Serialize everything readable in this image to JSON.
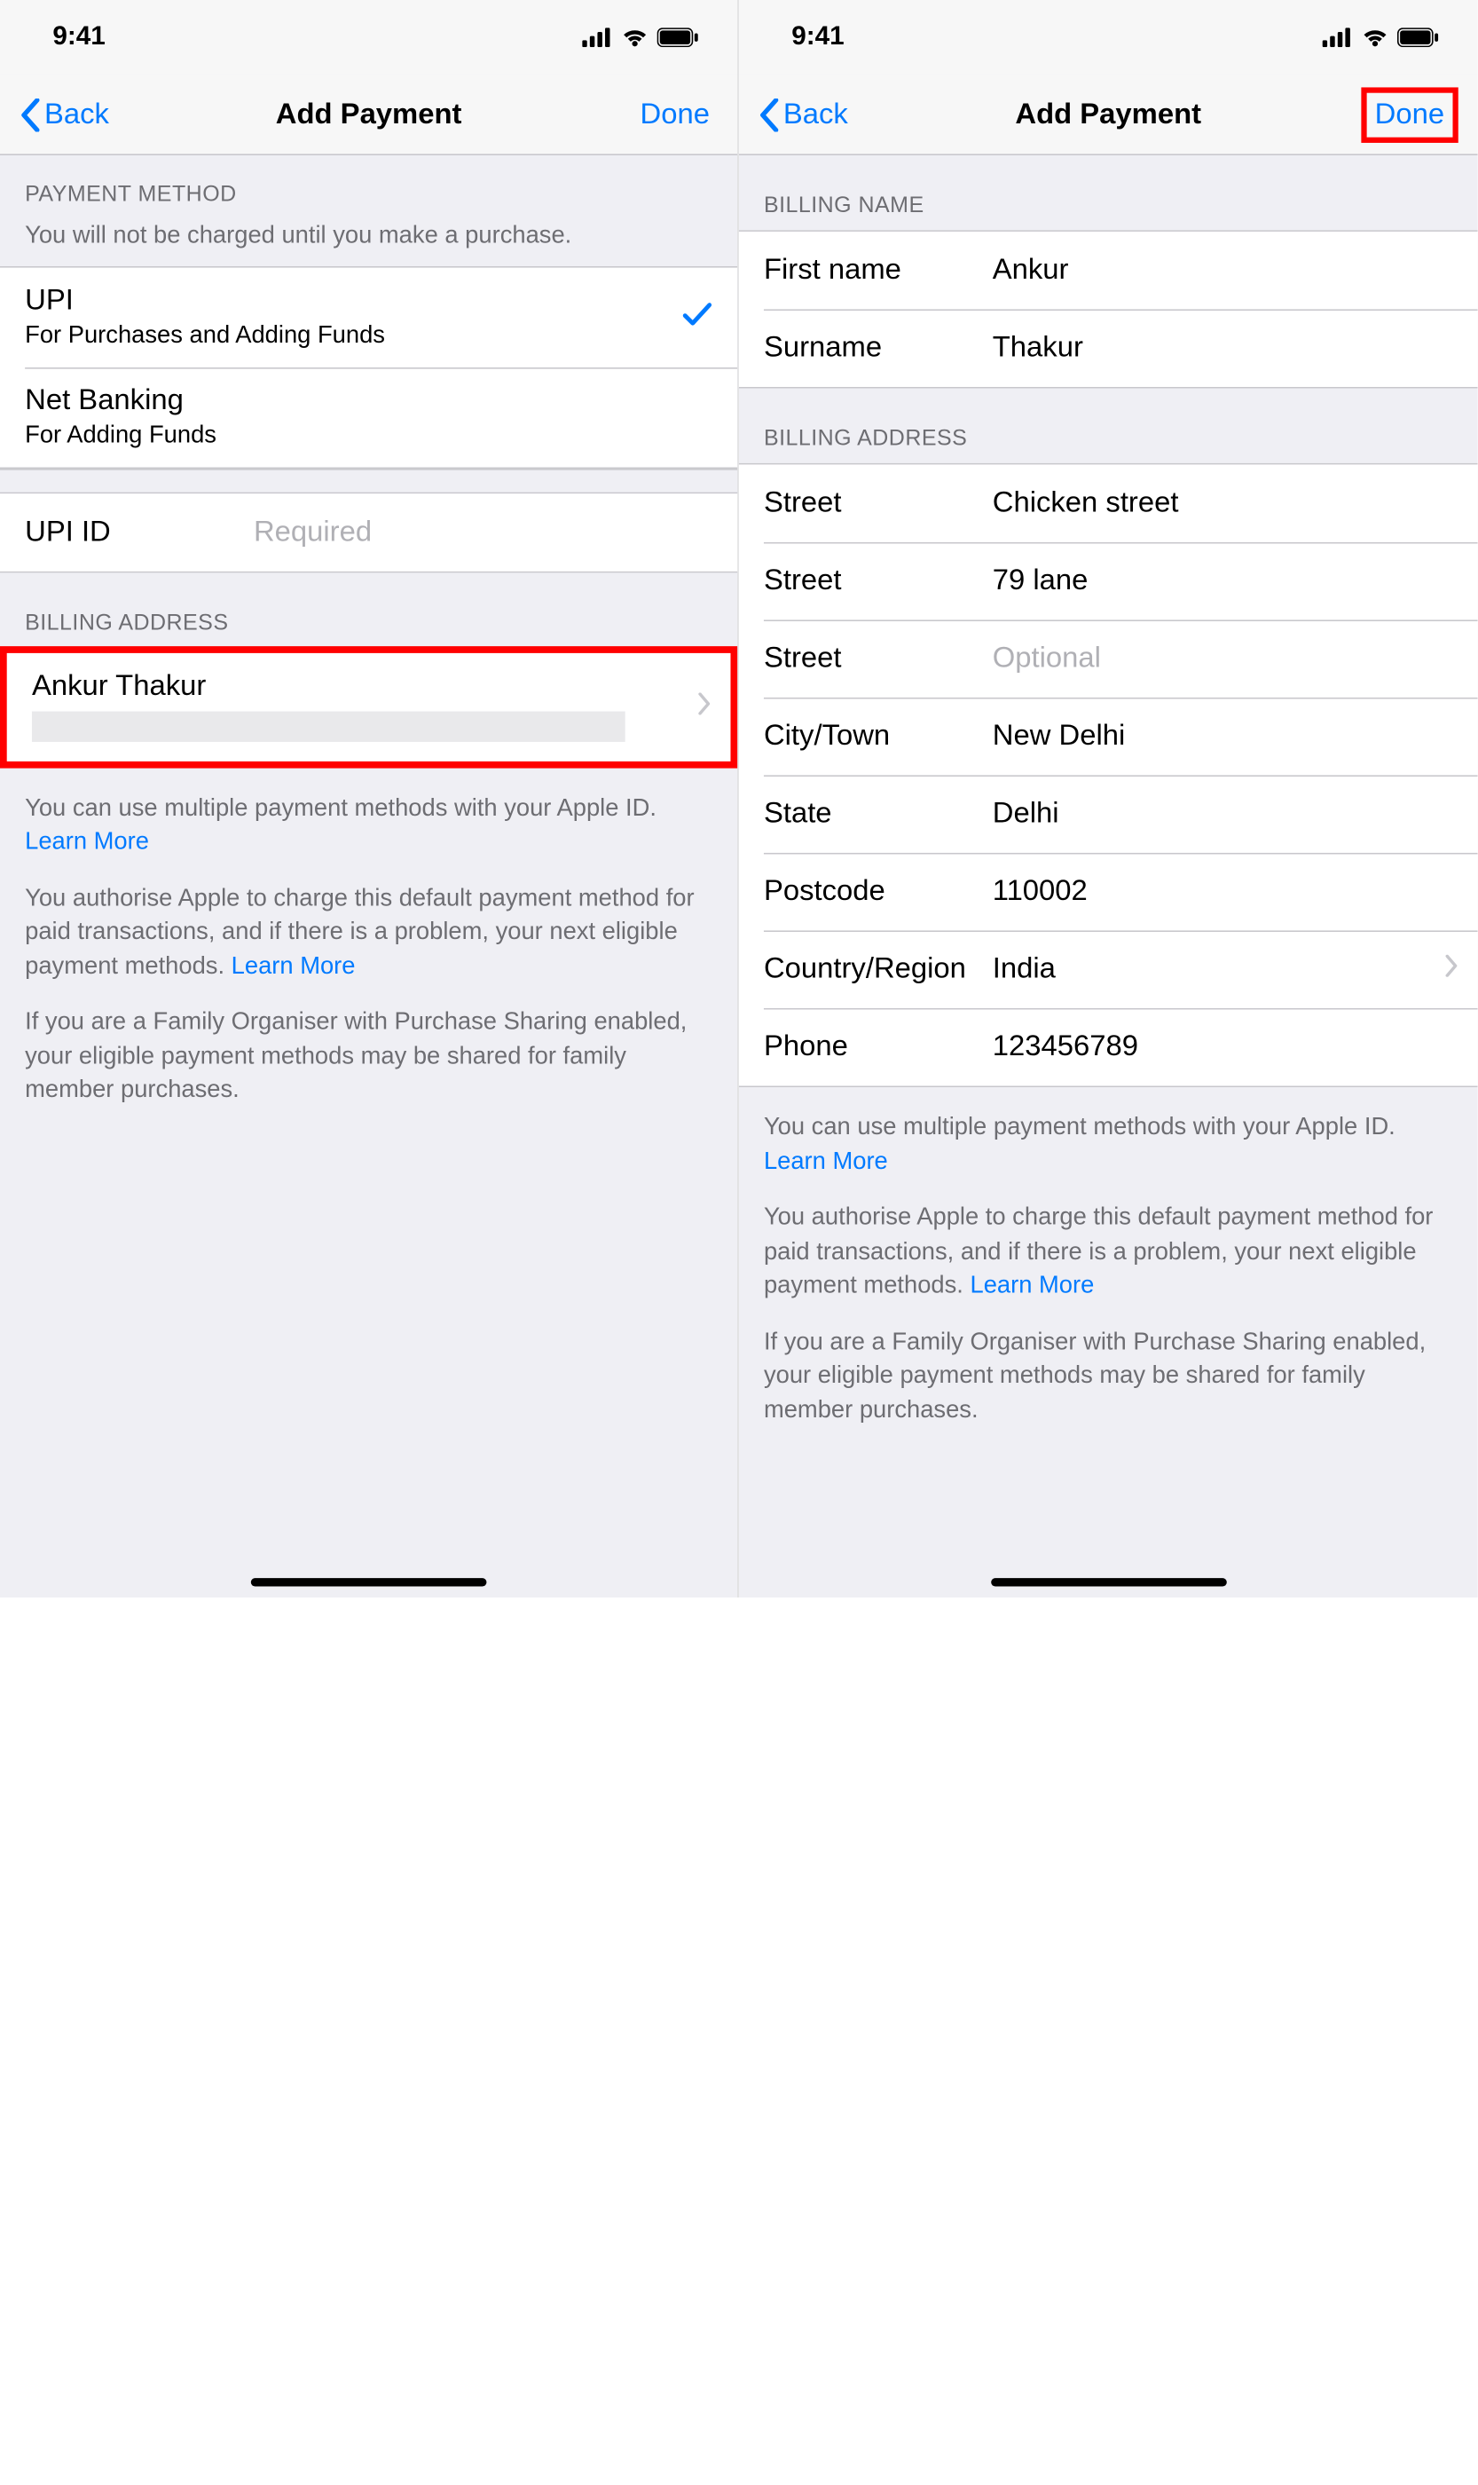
{
  "status": {
    "time": "9:41"
  },
  "nav": {
    "back": "Back",
    "title": "Add Payment",
    "done": "Done"
  },
  "screen1": {
    "payment_method_header": "PAYMENT METHOD",
    "payment_method_note": "You will not be charged until you make a purchase.",
    "methods": [
      {
        "title": "UPI",
        "sub": "For Purchases and Adding Funds",
        "selected": true
      },
      {
        "title": "Net Banking",
        "sub": "For Adding Funds",
        "selected": false
      }
    ],
    "upi_id_label": "UPI ID",
    "upi_id_placeholder": "Required",
    "billing_header": "BILLING ADDRESS",
    "billing_name": "Ankur Thakur"
  },
  "screen2": {
    "billing_name_header": "BILLING NAME",
    "first_name_label": "First name",
    "first_name_value": "Ankur",
    "surname_label": "Surname",
    "surname_value": "Thakur",
    "billing_address_header": "BILLING ADDRESS",
    "fields": {
      "street1_label": "Street",
      "street1_value": "Chicken street",
      "street2_label": "Street",
      "street2_value": "79 lane",
      "street3_label": "Street",
      "street3_placeholder": "Optional",
      "city_label": "City/Town",
      "city_value": "New Delhi",
      "state_label": "State",
      "state_value": "Delhi",
      "postcode_label": "Postcode",
      "postcode_value": "110002",
      "country_label": "Country/Region",
      "country_value": "India",
      "phone_label": "Phone",
      "phone_value": "123456789"
    }
  },
  "footer": {
    "p1": "You can use multiple payment methods with your Apple ID. ",
    "learn_more": "Learn More",
    "p2a": "You authorise Apple to charge this default payment method for paid transactions, and if there is a problem, your next eligible payment methods. ",
    "p3": "If you are a Family Organiser with Purchase Sharing enabled, your eligible payment methods may be shared for family member purchases."
  }
}
